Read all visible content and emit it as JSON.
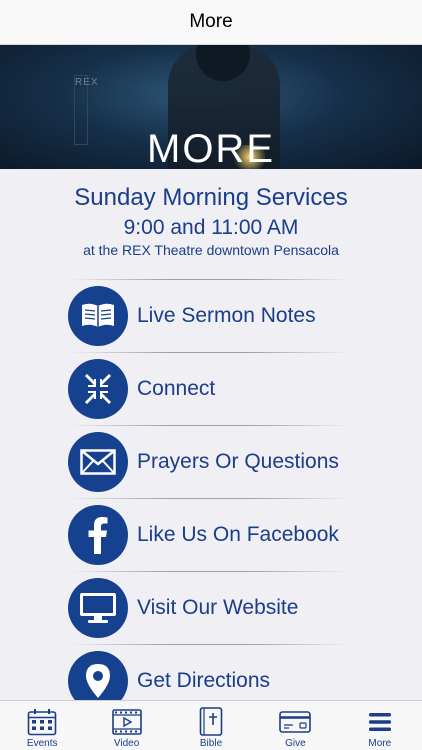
{
  "nav": {
    "title": "More"
  },
  "banner": {
    "title": "MORE",
    "sign_text": "REX"
  },
  "services": {
    "title": "Sunday Morning Services",
    "times": "9:00 and 11:00 AM",
    "venue": "at the REX Theatre downtown Pensacola"
  },
  "menu": {
    "items": [
      {
        "label": "Live Sermon Notes",
        "icon": "open-book-icon"
      },
      {
        "label": "Connect",
        "icon": "arrows-inward-icon"
      },
      {
        "label": "Prayers Or Questions",
        "icon": "envelope-icon"
      },
      {
        "label": "Like Us On Facebook",
        "icon": "facebook-icon"
      },
      {
        "label": "Visit Our Website",
        "icon": "monitor-icon"
      },
      {
        "label": "Get Directions",
        "icon": "map-pin-icon"
      }
    ]
  },
  "tabs": [
    {
      "label": "Events",
      "icon": "calendar-icon"
    },
    {
      "label": "Video",
      "icon": "video-icon"
    },
    {
      "label": "Bible",
      "icon": "bible-icon"
    },
    {
      "label": "Give",
      "icon": "card-icon"
    },
    {
      "label": "More",
      "icon": "menu-icon"
    }
  ],
  "colors": {
    "accent": "#1b3d8a",
    "icon_circle": "#16418f",
    "background": "#efeff4"
  }
}
